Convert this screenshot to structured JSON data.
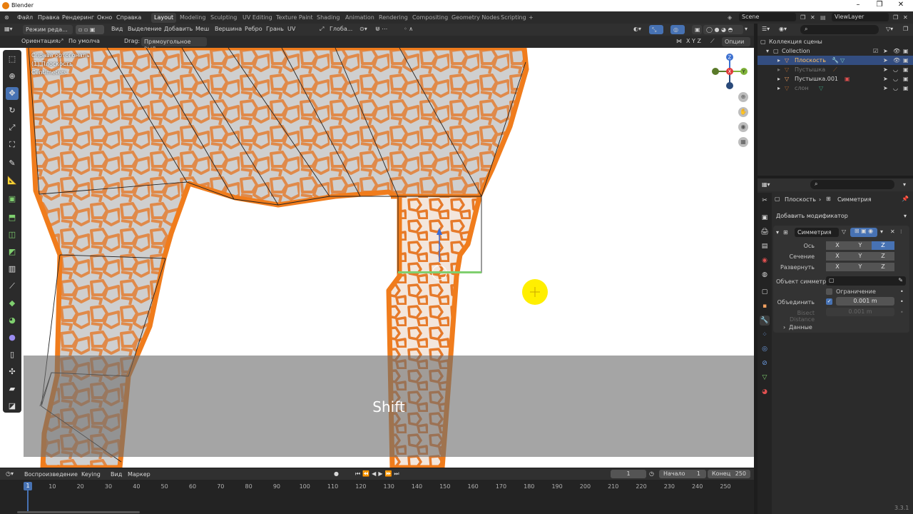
{
  "window": {
    "title": "Blender"
  },
  "menubar": {
    "items": [
      "Файл",
      "Правка",
      "Рендеринг",
      "Окно",
      "Справка"
    ],
    "workspaces": [
      "Layout",
      "Modeling",
      "Sculpting",
      "UV Editing",
      "Texture Paint",
      "Shading",
      "Animation",
      "Rendering",
      "Compositing",
      "Geometry Nodes",
      "Scripting"
    ],
    "active_workspace": "Layout",
    "scene": "Scene",
    "view_layer": "ViewLayer"
  },
  "viewport_header": {
    "mode": "Режим реда...",
    "menus": [
      "Вид",
      "Выделение",
      "Добавить",
      "Меш",
      "Вершина",
      "Ребро",
      "Грань",
      "UV"
    ],
    "transform": "Глоба...",
    "orientation_label": "Ориентация:",
    "orientation_value": "По умолча",
    "drag_label": "Drag:",
    "drag_value": "Прямоугольное выд...",
    "axes_label": "X Y Z",
    "options": "Опции"
  },
  "viewport": {
    "info_line1": "Справа ортогональ",
    "info_line2": "(1) Плоскость",
    "info_line3": "Centimeters",
    "key_overlay": "Shift"
  },
  "outliner": {
    "title": "Коллекция сцены",
    "items": [
      {
        "name": "Collection",
        "selected": false
      },
      {
        "name": "Плоскость",
        "selected": true
      },
      {
        "name": "Пустышка",
        "selected": false
      },
      {
        "name": "Пустышка.001",
        "selected": false
      },
      {
        "name": "слон",
        "selected": false
      }
    ]
  },
  "properties": {
    "breadcrumb_obj": "Плоскость",
    "breadcrumb_mod": "Симметрия",
    "add_modifier": "Добавить модификатор",
    "modifier_name": "Симметрия",
    "axis_label": "Ось",
    "bisect_label": "Сечение",
    "flip_label": "Развернуть",
    "axis_letters": [
      "X",
      "Y",
      "Z"
    ],
    "mirror_object_label": "Объект симметр...",
    "clipping_label": "Ограничение",
    "merge_label": "Объединить",
    "merge_value": "0.001 m",
    "bisect_distance_label": "Bisect Distance",
    "bisect_distance_value": "0.001 m",
    "data_label": "Данные"
  },
  "timeline": {
    "menus": [
      "Воспроизведение",
      "Keying",
      "Вид",
      "Маркер"
    ],
    "current_frame": "1",
    "start_label": "Начало",
    "start_value": "1",
    "end_label": "Конец",
    "end_value": "250",
    "ticks": [
      "10",
      "20",
      "30",
      "40",
      "50",
      "60",
      "70",
      "80",
      "90",
      "100",
      "110",
      "120",
      "130",
      "140",
      "150",
      "160",
      "170",
      "180",
      "190",
      "200",
      "210",
      "220",
      "230",
      "240",
      "250"
    ]
  },
  "status": {
    "version": "3.3.1"
  }
}
